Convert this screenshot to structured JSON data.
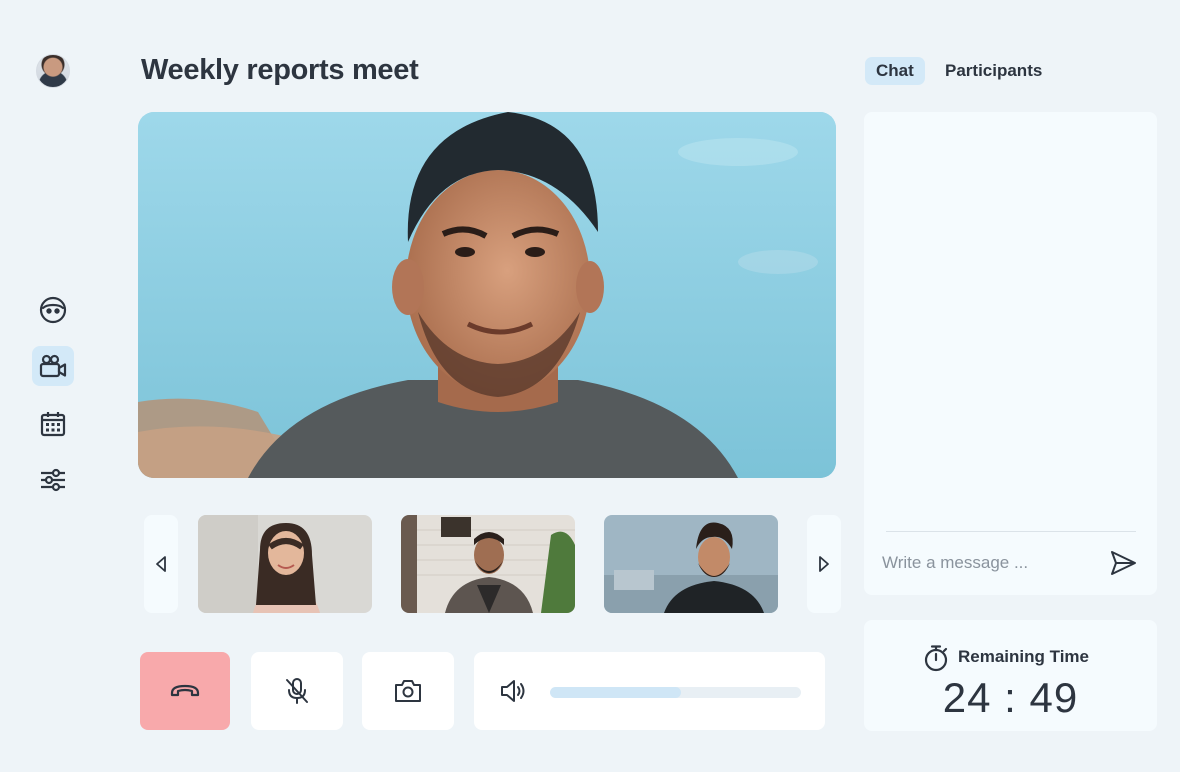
{
  "meeting": {
    "title": "Weekly reports meet"
  },
  "sidebar": {
    "items": [
      {
        "name": "discover",
        "icon": "smiley-icon"
      },
      {
        "name": "video",
        "icon": "video-camera-icon",
        "active": true
      },
      {
        "name": "calendar",
        "icon": "calendar-icon"
      },
      {
        "name": "settings",
        "icon": "sliders-icon"
      }
    ]
  },
  "tabs": [
    {
      "label": "Chat",
      "active": true
    },
    {
      "label": "Participants",
      "active": false
    }
  ],
  "chat": {
    "placeholder": "Write a message ..."
  },
  "controls": {
    "end_call_color": "#f8a9ab",
    "volume_level": 0.52
  },
  "timer": {
    "label": "Remaining Time",
    "value": "24 : 49"
  },
  "colors": {
    "background": "#eef4f8",
    "accent": "#d3e9f8",
    "panel": "#f5fbfe",
    "text": "#2d3540"
  }
}
